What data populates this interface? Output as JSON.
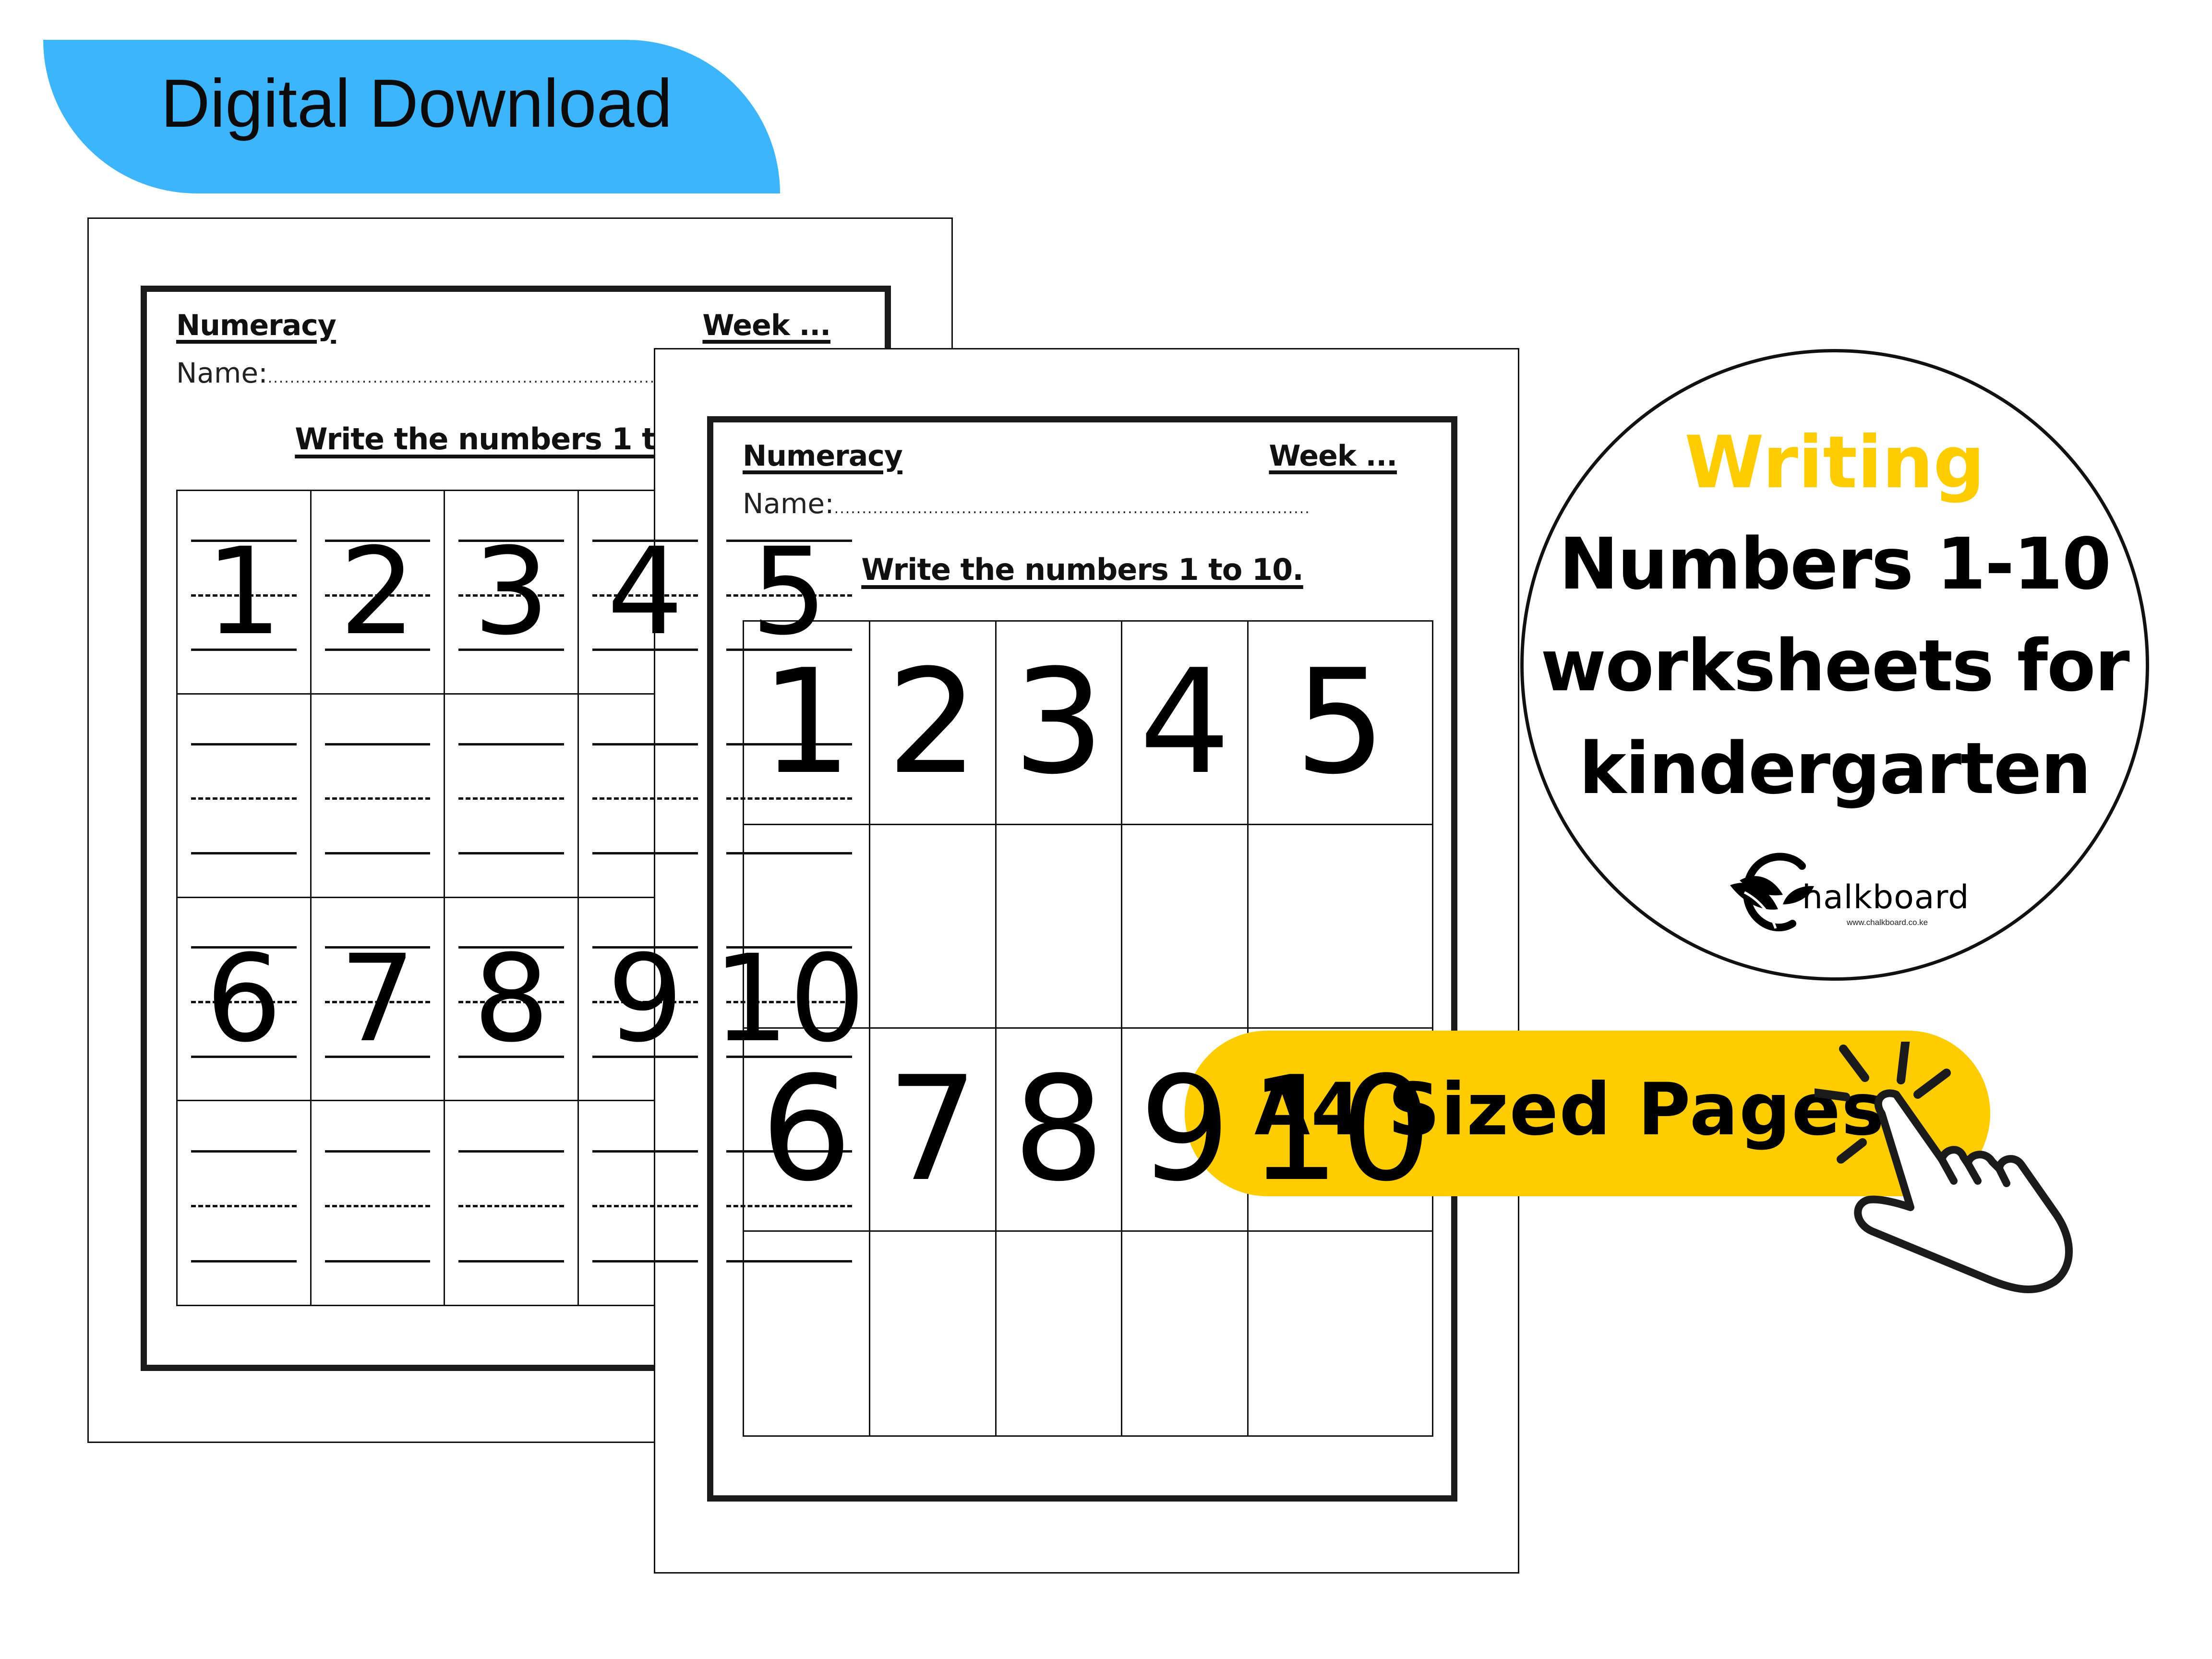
{
  "banner": {
    "label": "Digital Download",
    "color": "#3db5fc"
  },
  "worksheet": {
    "subject": "Numeracy",
    "week": "Week ...",
    "name_label": "Name:",
    "name_dots": "......................................................................................",
    "instruction": "Write the numbers 1 to 10.",
    "digits_row_1": [
      "1",
      "2",
      "3",
      "4",
      "5"
    ],
    "digits_row_2": [
      "6",
      "7",
      "8",
      "9",
      "10"
    ]
  },
  "badge": {
    "kicker": "Writing",
    "kicker_color": "#ffcc00",
    "line1": "Numbers 1-10",
    "line2": "worksheets for",
    "line3": "kindergarten",
    "logo_word": "halkboard",
    "logo_url": "www.chalkboard.co.ke"
  },
  "pill": {
    "label": "A4 Sized Pages",
    "color": "#ffcc00"
  },
  "icons": {
    "hand": "pointing-hand-click",
    "leaf": "leaf-logo"
  }
}
